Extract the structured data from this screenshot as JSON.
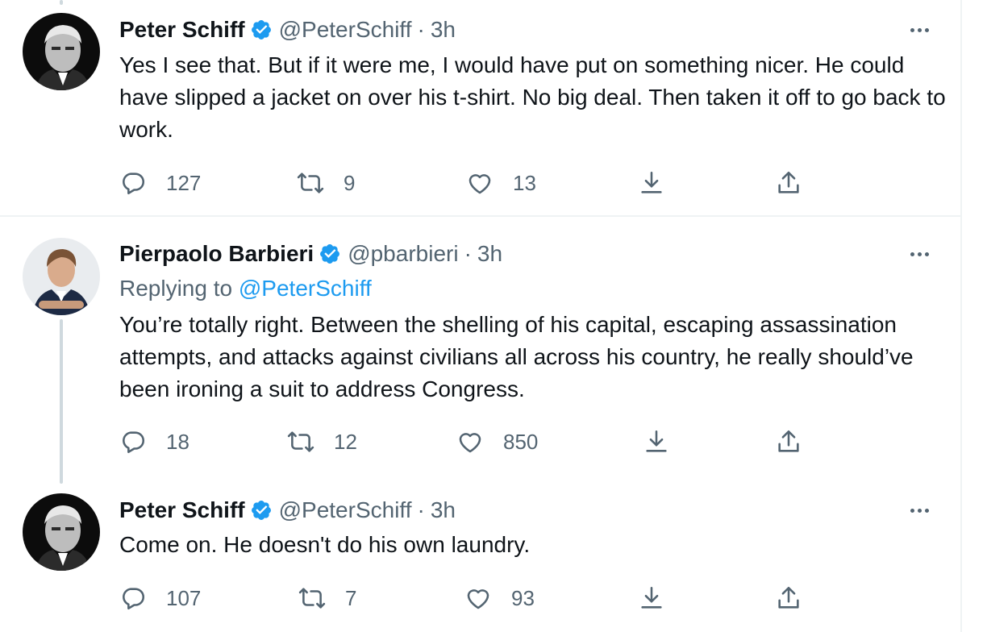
{
  "tweets": [
    {
      "name": "Peter Schiff",
      "handle": "@PeterSchiff",
      "separator": "·",
      "time": "3h",
      "text": "Yes I see that. But if it were me, I would have put on something nicer. He could have slipped a jacket on over his t-shirt. No big deal. Then taken it off to go back to work.",
      "replies": "127",
      "retweets": "9",
      "likes": "13"
    },
    {
      "name": "Pierpaolo Barbieri",
      "handle": "@pbarbieri",
      "separator": "·",
      "time": "3h",
      "replying_prefix": "Replying to",
      "replying_handle": "@PeterSchiff",
      "text": "You’re totally right. Between the shelling of his capital, escaping assassination attempts,  and attacks against civilians all across his country, he really should’ve been ironing a suit to address Congress.",
      "replies": "18",
      "retweets": "12",
      "likes": "850"
    },
    {
      "name": "Peter Schiff",
      "handle": "@PeterSchiff",
      "separator": "·",
      "time": "3h",
      "text": "Come on.  He doesn't do his own laundry.",
      "replies": "107",
      "retweets": "7",
      "likes": "93"
    }
  ],
  "colors": {
    "accent": "#1d9bf0",
    "secondary_text": "#536471",
    "primary_text": "#0f1419",
    "border": "#eff3f4"
  },
  "icons": [
    "verified-badge-icon",
    "more-options-icon",
    "reply-icon",
    "retweet-icon",
    "like-icon",
    "bookmark-icon",
    "share-icon"
  ]
}
